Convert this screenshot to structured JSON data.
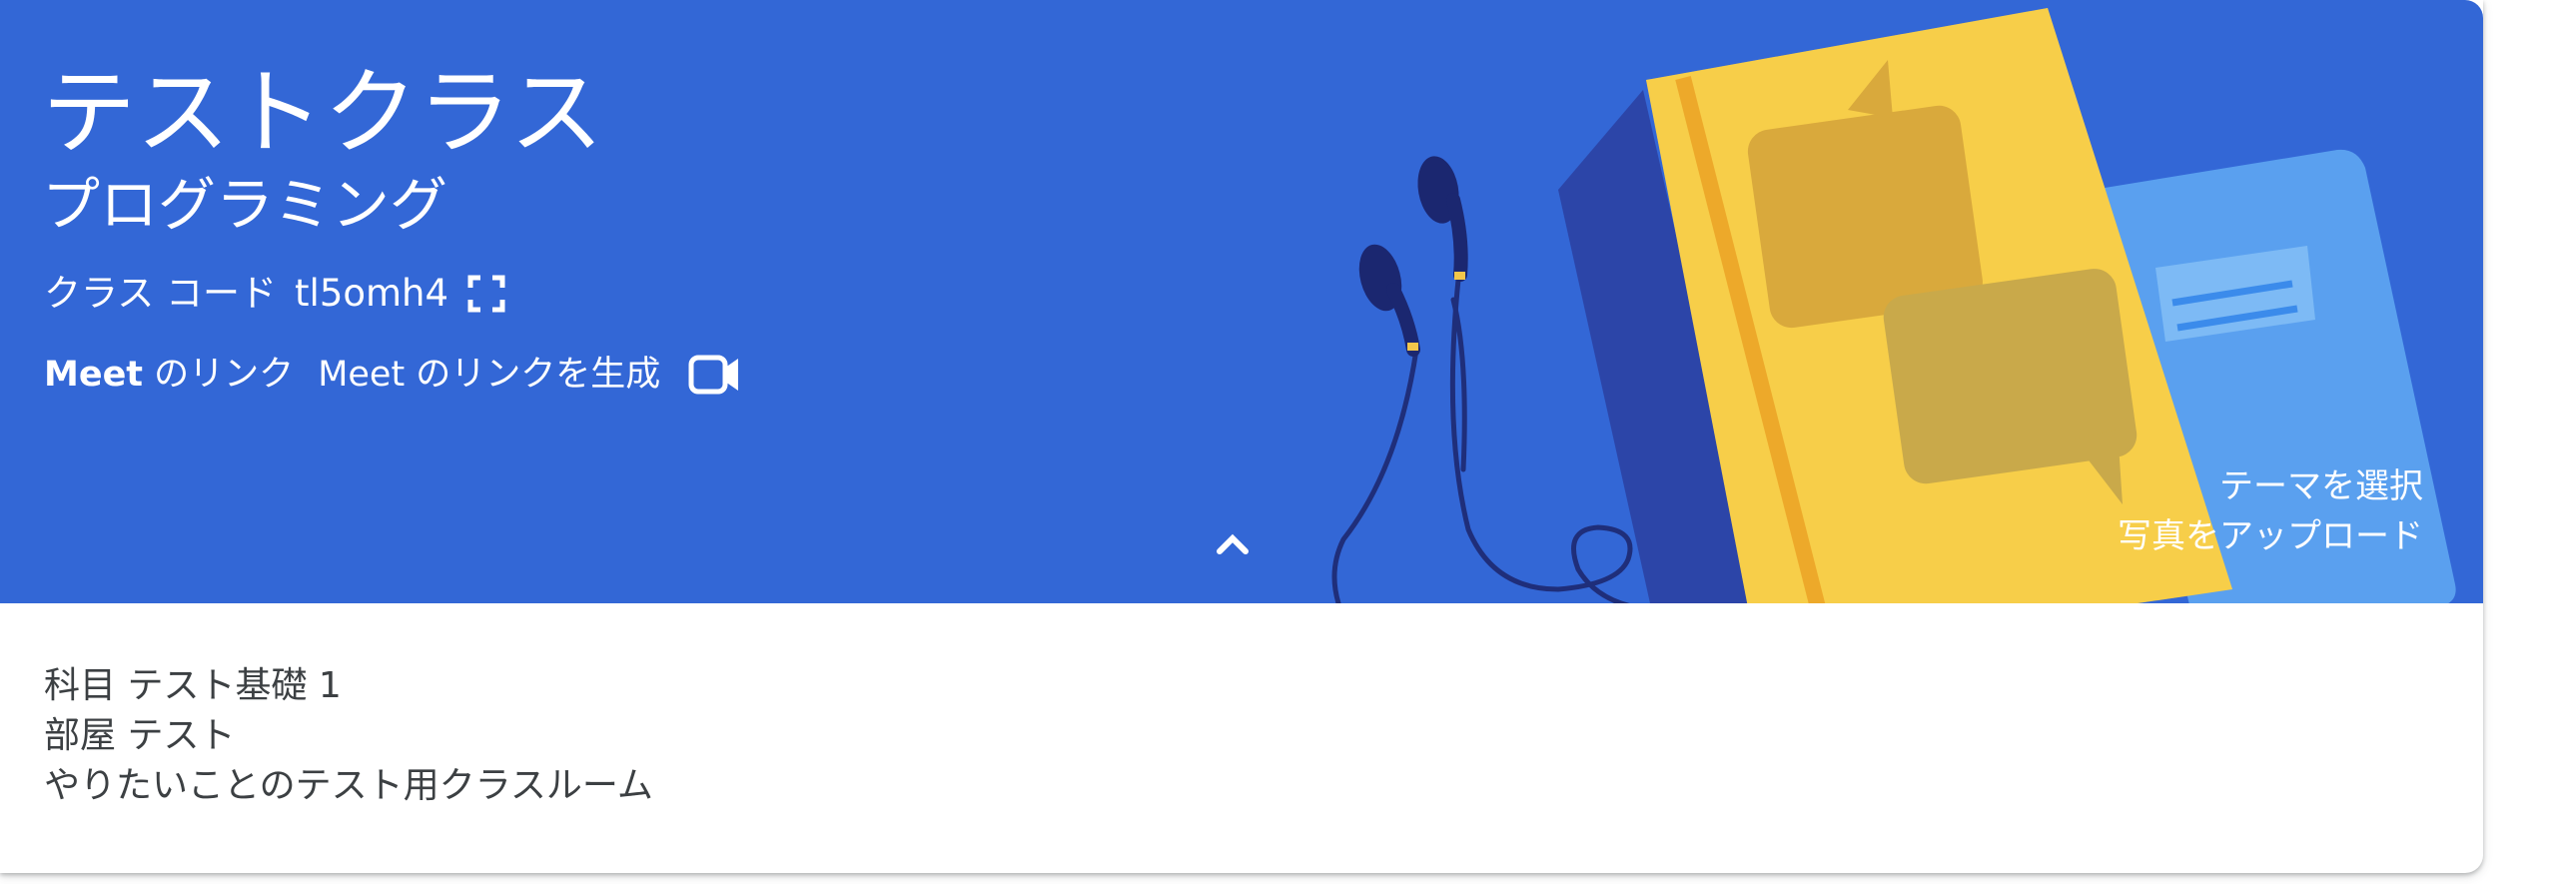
{
  "class_header": {
    "title": "テストクラス",
    "section": "プログラミング",
    "class_code_label": "クラス コード",
    "class_code_value": "tl5omh4",
    "meet_label_bold": "Meet",
    "meet_label_rest": " のリンク",
    "meet_generate_link": "Meet のリンクを生成",
    "select_theme": "テーマを選択",
    "upload_photo": "写真をアップロード"
  },
  "class_details": {
    "subject": "科目 テスト基礎 1",
    "room": "部屋 テスト",
    "description": "やりたいことのテスト用クラスルーム"
  },
  "colors": {
    "banner": "#3367d6",
    "text_on_banner": "#ffffff",
    "details_text": "#3c4043"
  },
  "icons": {
    "class_code_expand": "fullscreen-icon",
    "meet": "video-camera-icon",
    "collapse": "chevron-up-icon"
  }
}
